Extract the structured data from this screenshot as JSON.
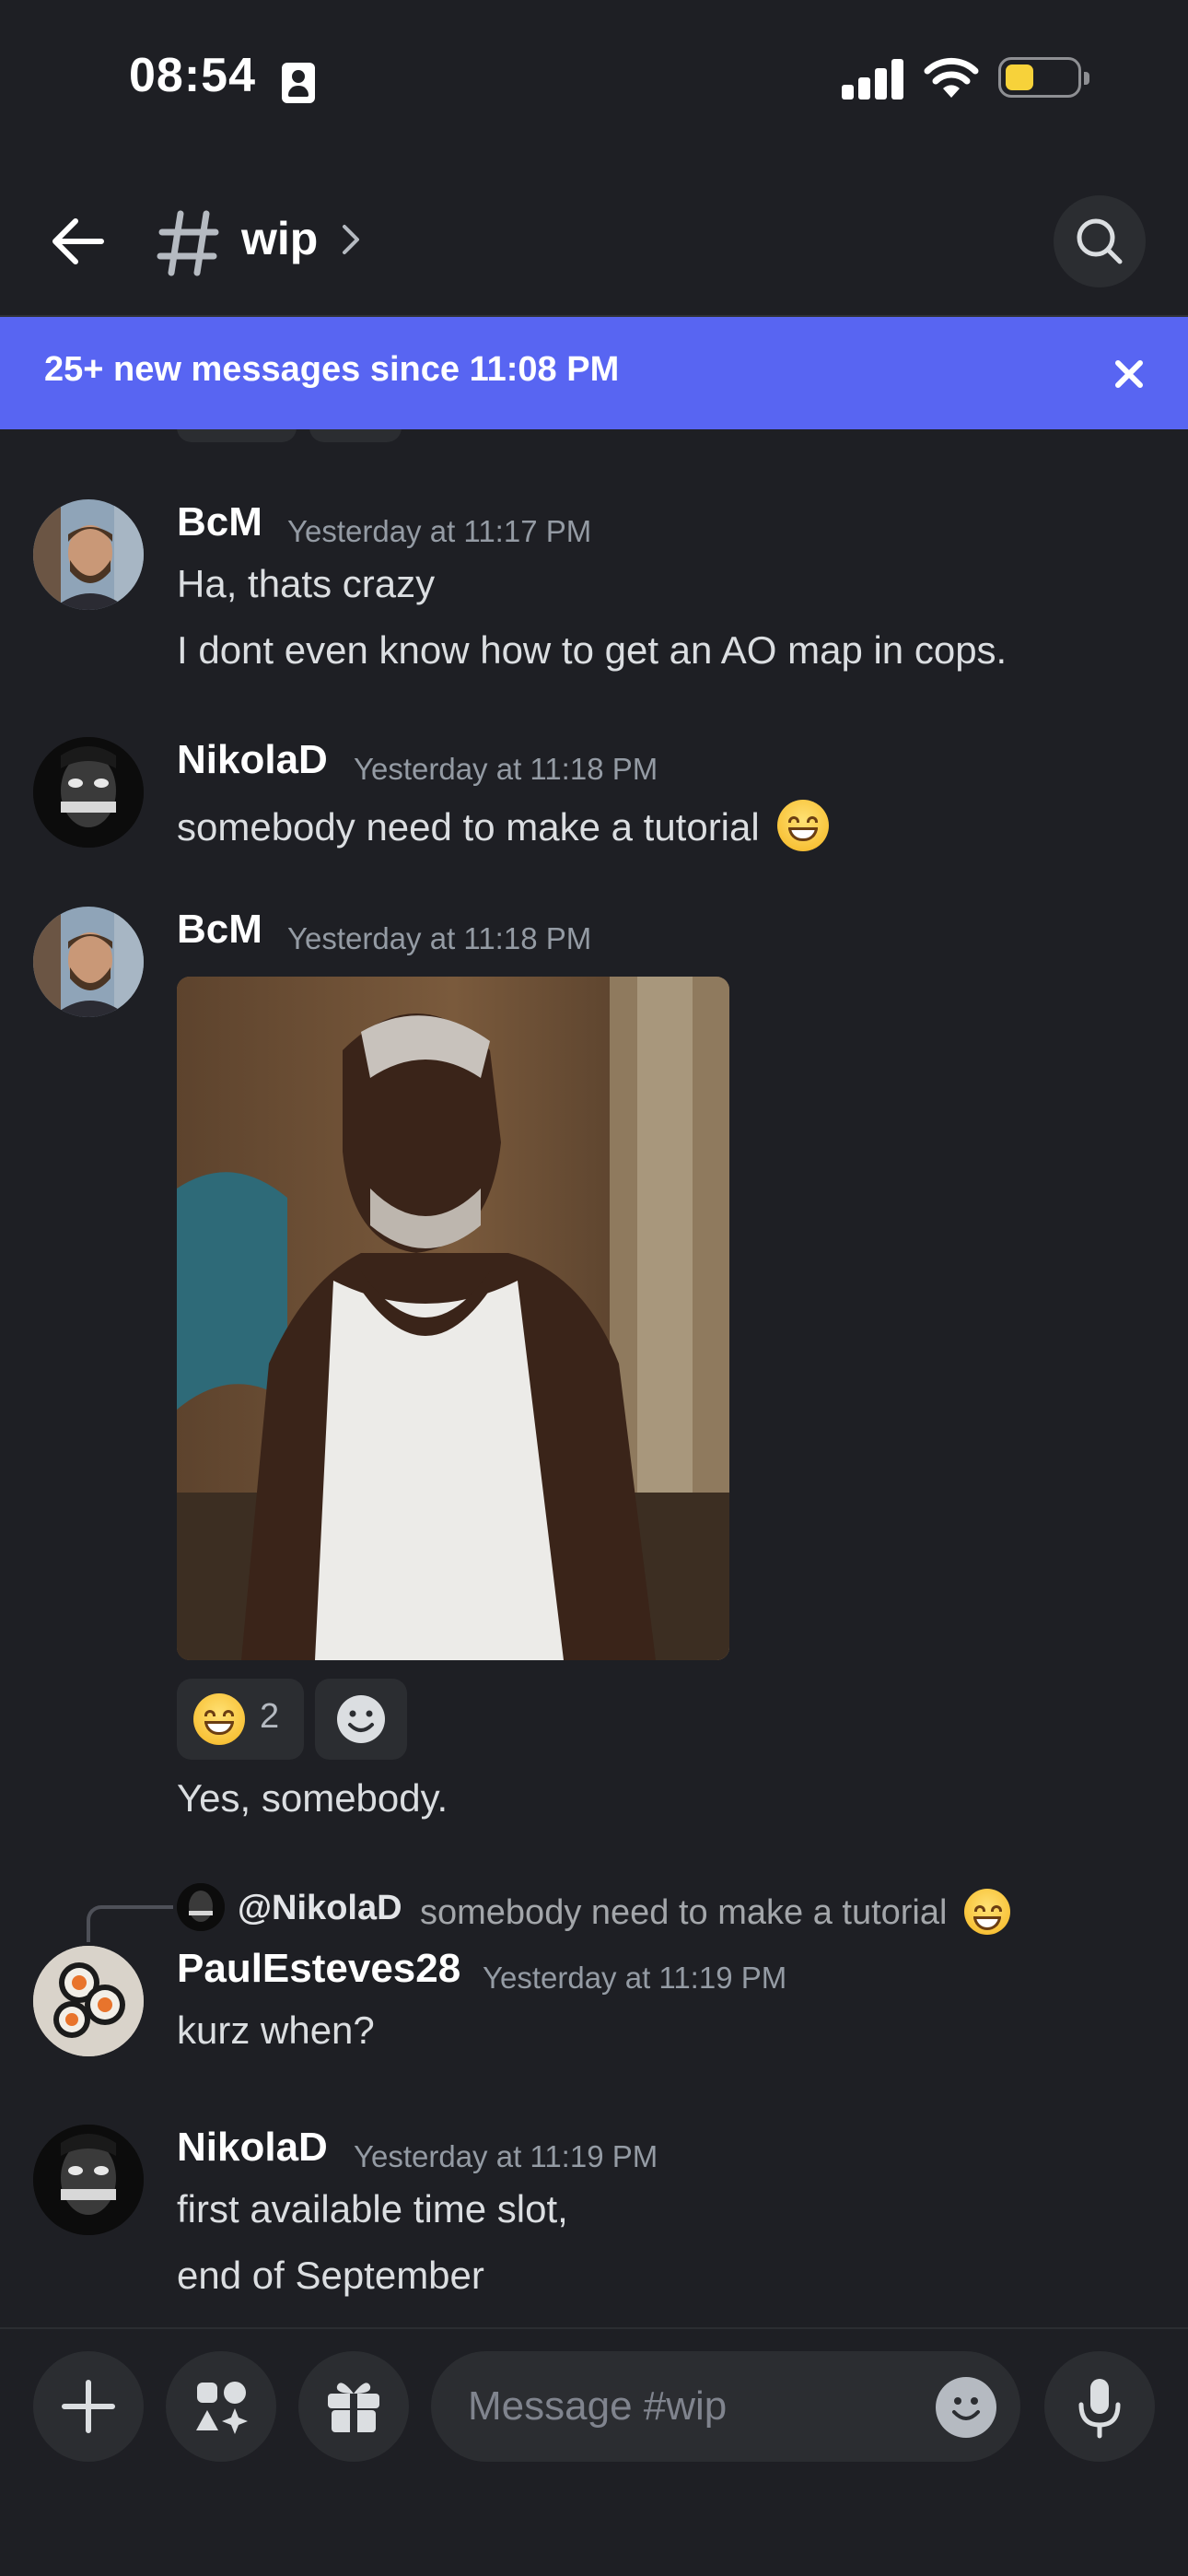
{
  "status_bar": {
    "time": "08:54"
  },
  "header": {
    "channel_name": "wip"
  },
  "banner": {
    "text": "25+ new messages since 11:08 PM"
  },
  "messages": [
    {
      "user": "BcM",
      "timestamp": "Yesterday at 11:17 PM",
      "lines": [
        "Ha, thats crazy",
        "I dont even know how to get an AO map in cops."
      ]
    },
    {
      "user": "NikolaD",
      "timestamp": "Yesterday at 11:18 PM",
      "lines": [
        "somebody need to make a tutorial"
      ]
    },
    {
      "user": "BcM",
      "timestamp": "Yesterday at 11:18 PM",
      "reaction_count": "2",
      "lines": [
        "Yes, somebody."
      ]
    },
    {
      "reply_to_user": "@NikolaD",
      "reply_to_text": "somebody need to make a tutorial",
      "user": "PaulEsteves28",
      "timestamp": "Yesterday at 11:19 PM",
      "lines": [
        "kurz when?"
      ]
    },
    {
      "user": "NikolaD",
      "timestamp": "Yesterday at 11:19 PM",
      "lines": [
        "first available time slot,",
        "end of September"
      ]
    }
  ],
  "composer": {
    "placeholder": "Message #wip"
  },
  "colors": {
    "accent": "#5865f2",
    "background": "#1e1f24",
    "surface": "#2b2d31"
  }
}
